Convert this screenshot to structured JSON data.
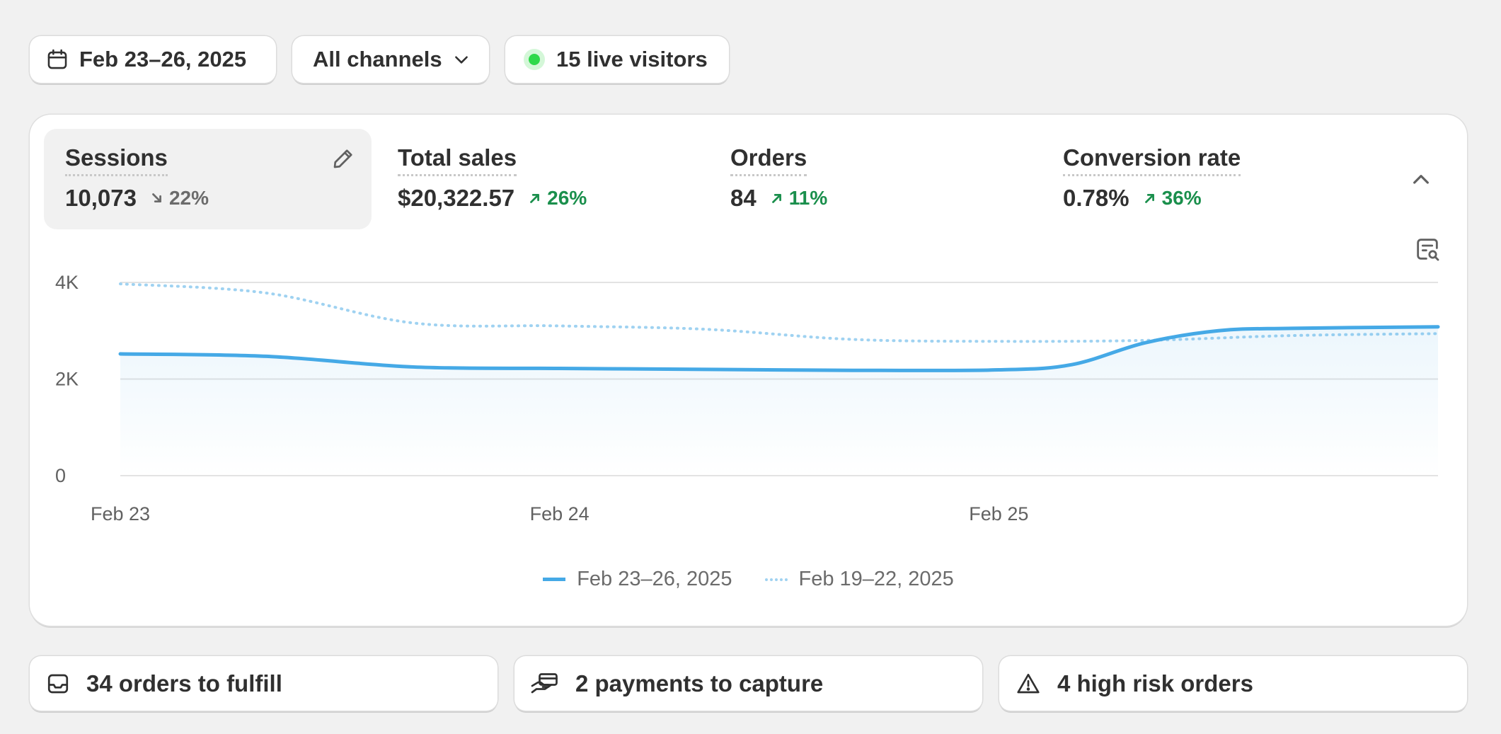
{
  "filters": {
    "date_range": "Feb 23–26, 2025",
    "channel": "All channels",
    "live_visitors": "15 live visitors"
  },
  "metrics": [
    {
      "title": "Sessions",
      "value": "10,073",
      "change": "22%",
      "direction": "down",
      "selected": true
    },
    {
      "title": "Total sales",
      "value": "$20,322.57",
      "change": "26%",
      "direction": "up",
      "selected": false
    },
    {
      "title": "Orders",
      "value": "84",
      "change": "11%",
      "direction": "up",
      "selected": false
    },
    {
      "title": "Conversion rate",
      "value": "0.78%",
      "change": "36%",
      "direction": "up",
      "selected": false
    }
  ],
  "colors": {
    "current_series": "#45a9e6",
    "previous_series": "#9fd2f1",
    "up": "#1a8f4c",
    "down": "#6b6b6b",
    "live": "#2ed94a"
  },
  "chart_data": {
    "type": "line",
    "y_ticks": [
      "4K",
      "2K",
      "0"
    ],
    "ylim": [
      0,
      4000
    ],
    "x_tick_labels": [
      "Feb 23",
      "Feb 24",
      "Feb 25"
    ],
    "grid": true,
    "series": [
      {
        "name": "Feb 23–26, 2025",
        "style": "solid",
        "x": [
          0,
          0.333,
          0.667,
          1.0,
          1.333,
          1.667,
          2.0,
          2.167,
          2.333,
          2.5,
          2.667,
          3.0
        ],
        "values": [
          2520,
          2470,
          2250,
          2220,
          2200,
          2180,
          2190,
          2300,
          2750,
          3000,
          3050,
          3080
        ]
      },
      {
        "name": "Feb 19–22, 2025",
        "style": "dotted",
        "x": [
          0,
          0.333,
          0.667,
          1.0,
          1.333,
          1.667,
          2.0,
          2.333,
          2.667,
          3.0
        ],
        "values": [
          3970,
          3780,
          3160,
          3100,
          3030,
          2820,
          2780,
          2800,
          2900,
          2940
        ]
      }
    ]
  },
  "tasks": [
    {
      "label": "34 orders to fulfill"
    },
    {
      "label": "2 payments to capture"
    },
    {
      "label": "4 high risk orders"
    }
  ]
}
